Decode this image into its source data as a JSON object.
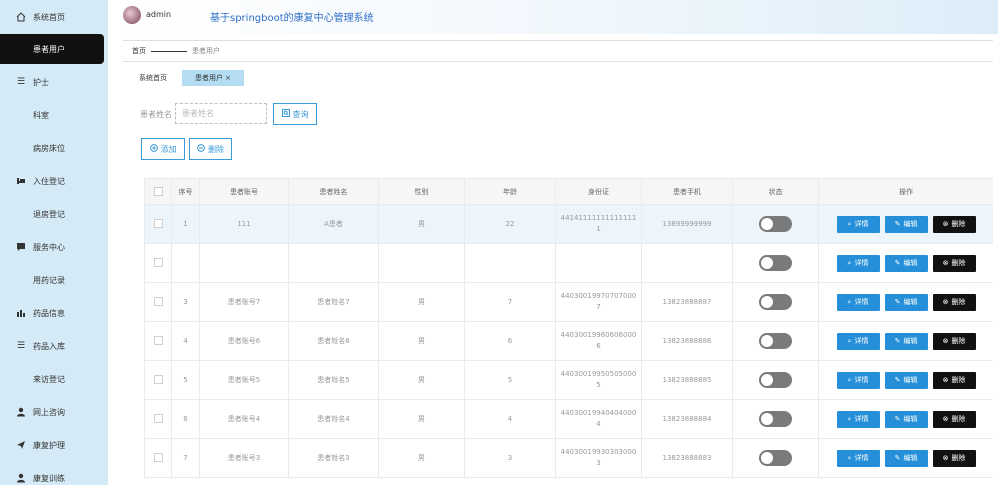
{
  "app": {
    "username": "admin",
    "title": "基于springboot的康复中心管理系统"
  },
  "sidebar": {
    "items": [
      {
        "label": "系统首页",
        "icon": "home-icon"
      },
      {
        "label": "患者用户",
        "icon": "grid-icon"
      },
      {
        "label": "护士",
        "icon": "list-icon"
      },
      {
        "label": "科室",
        "icon": "grid-icon"
      },
      {
        "label": "病房床位",
        "icon": "grid-icon"
      },
      {
        "label": "入住登记",
        "icon": "bed-icon"
      },
      {
        "label": "退房登记",
        "icon": "grid-icon"
      },
      {
        "label": "服务中心",
        "icon": "chat-icon"
      },
      {
        "label": "用药记录",
        "icon": "grid-icon"
      },
      {
        "label": "药品信息",
        "icon": "chart-icon"
      },
      {
        "label": "药品入库",
        "icon": "list-icon"
      },
      {
        "label": "来访登记",
        "icon": "grid-icon"
      },
      {
        "label": "网上咨询",
        "icon": "user-icon"
      },
      {
        "label": "康复护理",
        "icon": "send-icon"
      },
      {
        "label": "康复训练",
        "icon": "user-icon"
      }
    ]
  },
  "breadcrumb": {
    "home": "首页",
    "current": "患者用户"
  },
  "tabs": [
    {
      "label": "系统首页"
    },
    {
      "label": "患者用户 ×"
    }
  ],
  "search": {
    "label": "患者姓名",
    "placeholder": "患者姓名",
    "button": "查询"
  },
  "actions": {
    "add": "添加",
    "delete": "删除"
  },
  "table": {
    "headers": [
      "",
      "序号",
      "患者账号",
      "患者姓名",
      "性别",
      "年龄",
      "身份证",
      "患者手机",
      "状态",
      "操作"
    ],
    "rows": [
      {
        "index": "1",
        "account": "111",
        "name": "A患者",
        "gender": "男",
        "age": "22",
        "id_card": "441411111111111111",
        "phone": "13899999999"
      },
      {
        "index": "",
        "account": "",
        "name": "",
        "gender": "",
        "age": "",
        "id_card": "",
        "phone": ""
      },
      {
        "index": "3",
        "account": "患者账号7",
        "name": "患者姓名7",
        "gender": "男",
        "age": "7",
        "id_card": "440300199707070007",
        "phone": "13823888887"
      },
      {
        "index": "4",
        "account": "患者账号6",
        "name": "患者姓名6",
        "gender": "男",
        "age": "6",
        "id_card": "440300199606060006",
        "phone": "13823888886"
      },
      {
        "index": "5",
        "account": "患者账号5",
        "name": "患者姓名5",
        "gender": "男",
        "age": "5",
        "id_card": "440300199505050005",
        "phone": "13823888885"
      },
      {
        "index": "6",
        "account": "患者账号4",
        "name": "患者姓名4",
        "gender": "男",
        "age": "4",
        "id_card": "440300199404040004",
        "phone": "13823888884"
      },
      {
        "index": "7",
        "account": "患者账号3",
        "name": "患者姓名3",
        "gender": "男",
        "age": "3",
        "id_card": "440300199303030003",
        "phone": "13823888883"
      }
    ],
    "ops": {
      "detail": "详情",
      "edit": "编辑",
      "remove": "删除"
    }
  }
}
